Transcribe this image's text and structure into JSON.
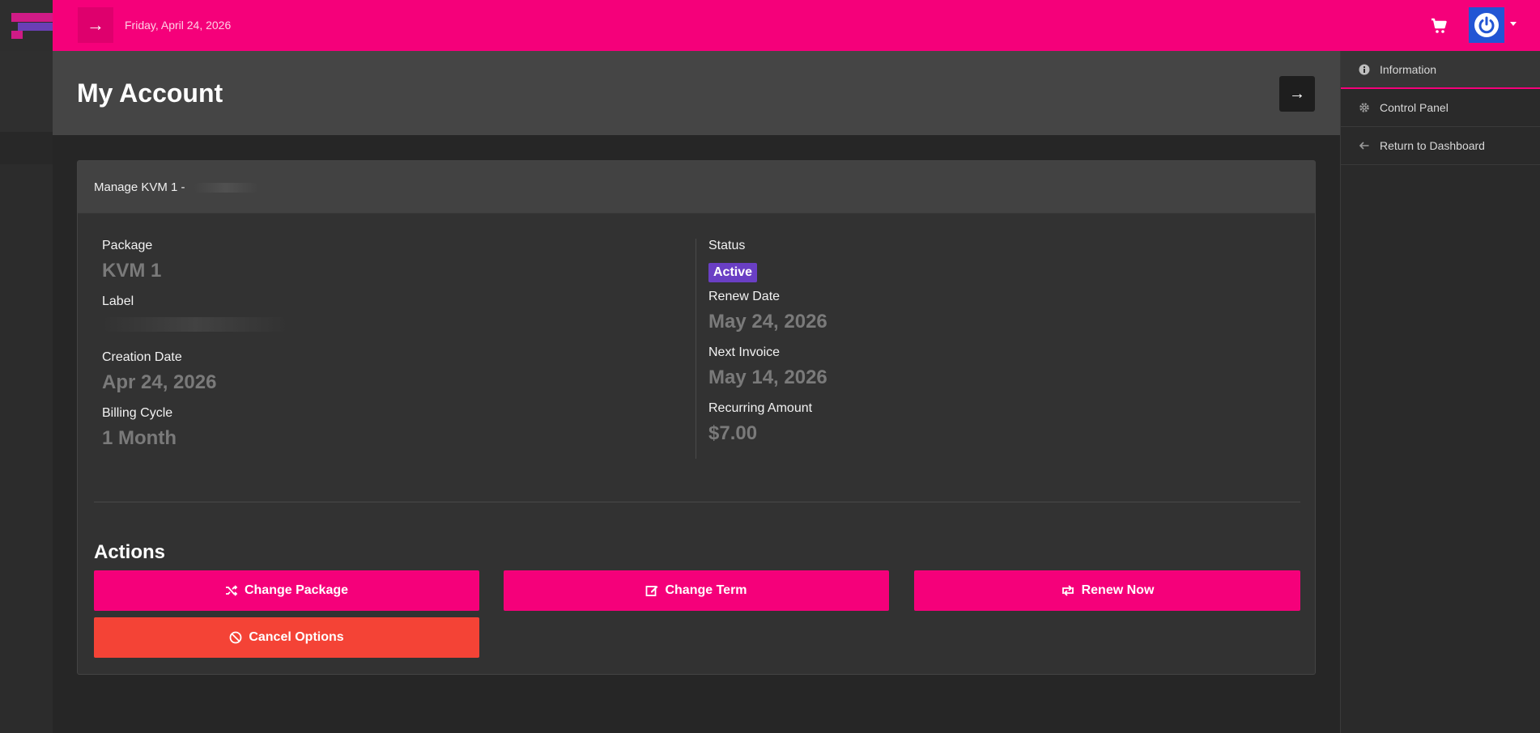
{
  "header": {
    "date": "Friday, April 24, 2026"
  },
  "page": {
    "title": "My Account"
  },
  "card": {
    "heading": "Manage KVM 1 -",
    "left": {
      "package_label": "Package",
      "package_value": "KVM 1",
      "label_label": "Label",
      "creation_label": "Creation Date",
      "creation_value": "Apr 24, 2026",
      "billing_label": "Billing Cycle",
      "billing_value": "1 Month"
    },
    "right": {
      "status_label": "Status",
      "status_value": "Active",
      "renew_label": "Renew Date",
      "renew_value": "May 24, 2026",
      "invoice_label": "Next Invoice",
      "invoice_value": "May 14, 2026",
      "amount_label": "Recurring Amount",
      "amount_value": "$7.00"
    }
  },
  "actions": {
    "title": "Actions",
    "change_package": "Change Package",
    "change_term": "Change Term",
    "renew_now": "Renew Now",
    "cancel_options": "Cancel Options"
  },
  "sidebar": {
    "items": [
      {
        "label": "Information",
        "icon": "info-icon"
      },
      {
        "label": "Control Panel",
        "icon": "gear-icon"
      },
      {
        "label": "Return to Dashboard",
        "icon": "arrow-left-icon"
      }
    ]
  },
  "colors": {
    "brand": "#f5007a",
    "danger": "#f44336",
    "status_active": "#6a3fc4",
    "power": "#2255d4"
  }
}
